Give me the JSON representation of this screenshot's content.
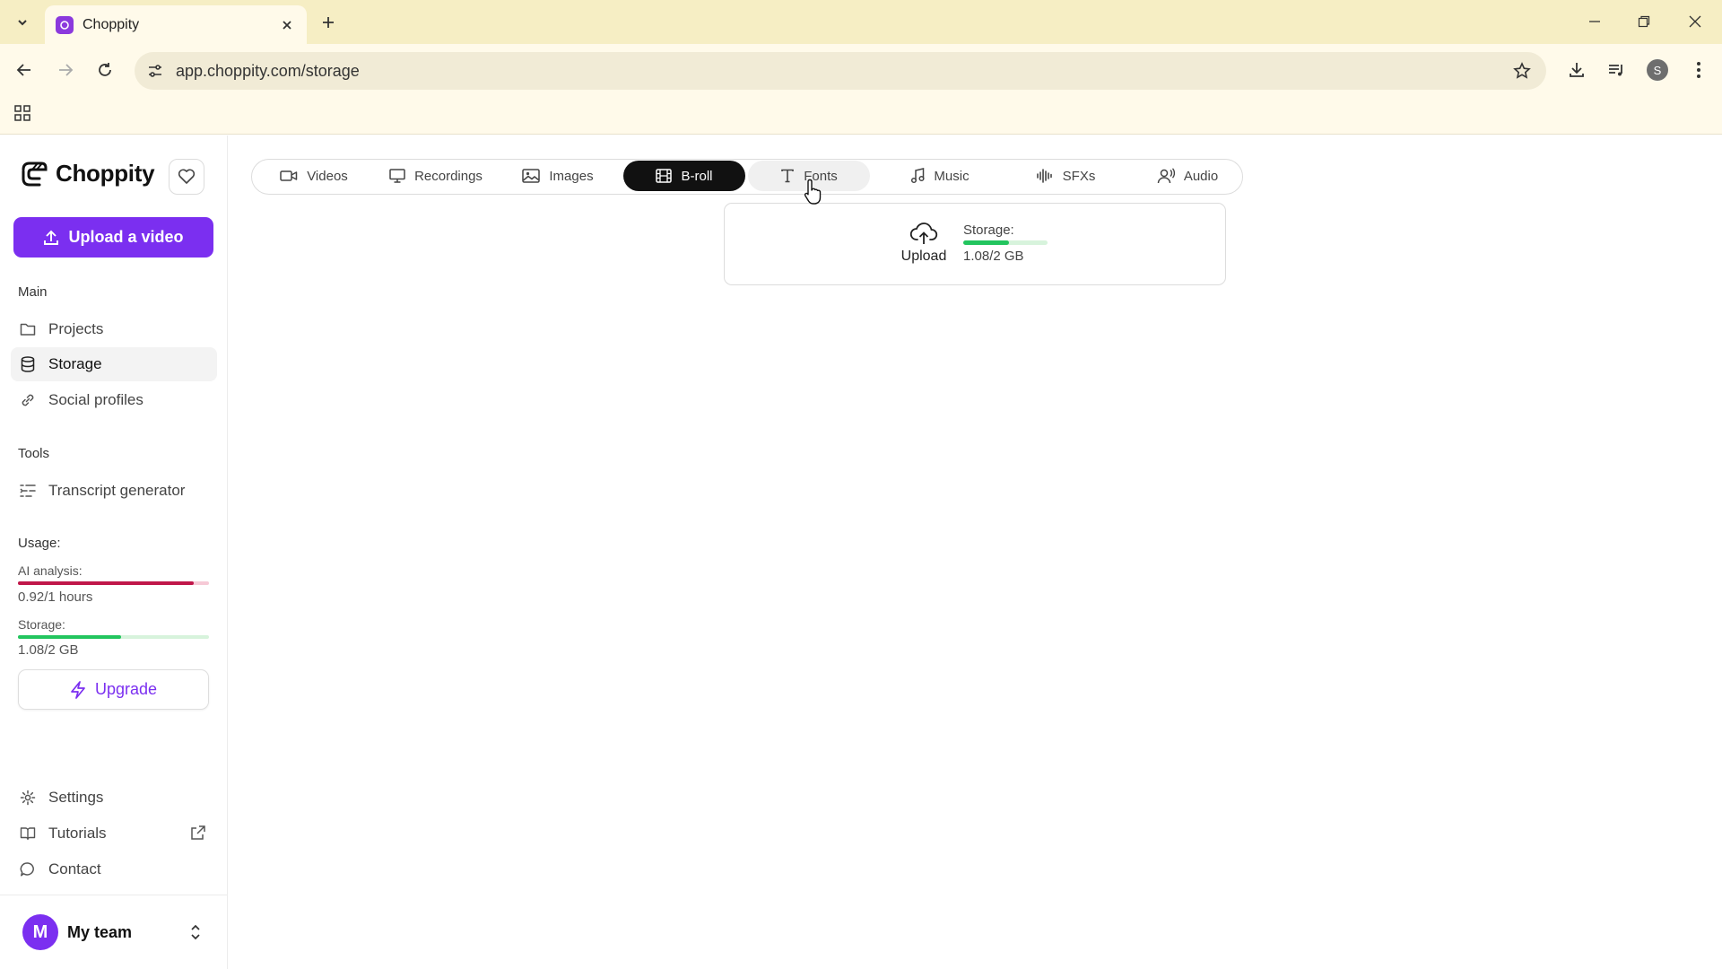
{
  "browser": {
    "tab_title": "Choppity",
    "url": "app.choppity.com/storage",
    "profile_initial": "S"
  },
  "sidebar": {
    "brand": "Choppity",
    "upload_button": "Upload a video",
    "sections": {
      "main": "Main",
      "tools": "Tools",
      "usage": "Usage:"
    },
    "main_items": [
      {
        "label": "Projects",
        "icon": "folder-icon"
      },
      {
        "label": "Storage",
        "icon": "database-icon",
        "active": true
      },
      {
        "label": "Social profiles",
        "icon": "link-icon"
      }
    ],
    "tools_items": [
      {
        "label": "Transcript generator",
        "icon": "transcript-icon"
      }
    ],
    "usage": {
      "ai_label": "AI analysis:",
      "ai_value": "0.92/1 hours",
      "ai_fraction": 0.92,
      "storage_label": "Storage:",
      "storage_value": "1.08/2 GB",
      "storage_fraction": 0.54
    },
    "upgrade_button": "Upgrade",
    "bottom_items": [
      {
        "label": "Settings",
        "icon": "gear-icon"
      },
      {
        "label": "Tutorials",
        "icon": "book-icon",
        "external": true
      },
      {
        "label": "Contact",
        "icon": "chat-icon"
      }
    ],
    "team": {
      "initial": "M",
      "name": "My team"
    }
  },
  "main": {
    "tabs": [
      {
        "label": "Videos",
        "icon": "video-icon"
      },
      {
        "label": "Recordings",
        "icon": "monitor-icon"
      },
      {
        "label": "Images",
        "icon": "image-icon"
      },
      {
        "label": "B-roll",
        "icon": "film-icon",
        "active": true
      },
      {
        "label": "Fonts",
        "icon": "type-icon",
        "hover": true
      },
      {
        "label": "Music",
        "icon": "music-icon"
      },
      {
        "label": "SFXs",
        "icon": "waveform-icon"
      },
      {
        "label": "Audio",
        "icon": "voice-icon"
      }
    ],
    "storage_card": {
      "upload_label": "Upload",
      "storage_label": "Storage:",
      "storage_value": "1.08/2 GB",
      "storage_fraction": 0.54
    }
  },
  "colors": {
    "accent": "#7b2ff0",
    "ai_bar": "#c0174a",
    "ai_bar_track": "#f6c9d6",
    "storage_bar": "#22c55e",
    "storage_bar_track": "#d7f3dc",
    "chrome_bg": "#f6eec4"
  }
}
